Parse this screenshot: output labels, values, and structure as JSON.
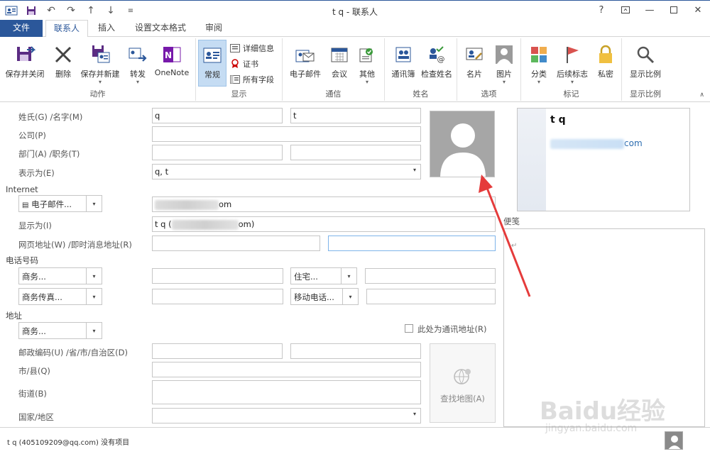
{
  "window": {
    "title": "t q - 联系人"
  },
  "tabs": [
    {
      "label": "文件"
    },
    {
      "label": "联系人"
    },
    {
      "label": "插入"
    },
    {
      "label": "设置文本格式"
    },
    {
      "label": "审阅"
    }
  ],
  "ribbon": {
    "groups": {
      "actions": "动作",
      "show": "显示",
      "communicate": "通信",
      "names": "姓名",
      "options": "选项",
      "tags": "标记",
      "zoom": "显示比例"
    },
    "buttons": {
      "save_close": "保存并关闭",
      "delete": "删除",
      "save_new": "保存并新建",
      "forward": "转发",
      "onenote": "OneNote",
      "general": "常规",
      "details": "详细信息",
      "certificates": "证书",
      "all_fields": "所有字段",
      "email": "电子邮件",
      "meeting": "会议",
      "more": "其他",
      "address_book": "通讯簿",
      "check_names": "检查姓名",
      "business_card": "名片",
      "picture": "图片",
      "categorize": "分类",
      "follow_up": "后续标志",
      "private": "私密",
      "zoom": "显示比例"
    }
  },
  "form": {
    "labels": {
      "full_name": "姓氏(G)  /名字(M)",
      "company": "公司(P)",
      "department": "部门(A)  /职务(T)",
      "file_as": "表示为(E)",
      "internet": "Internet",
      "display_as": "显示为(I)",
      "web_im": "网页地址(W)  /即时消息地址(R)",
      "phone_numbers": "电话号码",
      "addresses": "地址",
      "postal_region": "邮政编码(U)  /省/市/自治区(D)",
      "city": "市/县(Q)",
      "street": "街道(B)",
      "country": "国家/地区",
      "mailing_address": "此处为通讯地址(R)",
      "map_it": "查找地图(A)",
      "notes": "便笺"
    },
    "values": {
      "last_name": "q",
      "first_name": "t",
      "file_as": "q, t",
      "email_suffix": "om",
      "display_prefix": "t q (",
      "display_suffix": "om)"
    },
    "combos": {
      "email": "电子邮件...",
      "phone1": "商务...",
      "phone2": "住宅...",
      "phone3": "商务传真...",
      "phone4": "移动电话...",
      "address": "商务..."
    }
  },
  "business_card": {
    "name": "t q",
    "email_suffix": "com"
  },
  "status": {
    "text": "t q (405109209@qq.com)  没有项目"
  },
  "watermark": {
    "logo": "Baidu经验",
    "url": "jingyan.baidu.com"
  }
}
